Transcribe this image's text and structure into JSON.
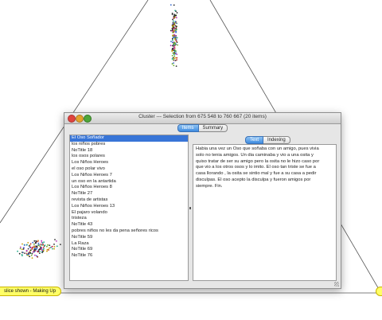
{
  "window": {
    "title": "Cluster --- Selection from 675 548 to 760 667 (20 items)",
    "tabs": [
      {
        "label": "Items",
        "active": true
      },
      {
        "label": "Summary",
        "active": false
      }
    ],
    "detail_tabs": [
      {
        "label": "Text",
        "active": true
      },
      {
        "label": "Indexing",
        "active": false
      }
    ]
  },
  "list": {
    "selected_index": 0,
    "items": [
      "El Oso Soñador",
      "los niños pobres",
      "NoTitle 18",
      "los osos polares",
      "Los Niños Heroes",
      "el oso polar vivo",
      "Los Niños Heroes 7",
      "un oso en la antartida",
      "Los Niños Heroes 8",
      "NoTitle 27",
      "revista de artistas",
      "Los Niños Heroes 13",
      "El pajaro volando",
      "tristeza",
      "NoTitle 43",
      "pobres niños no les da pena señores ricos",
      "NoTitle 59",
      "La Raza",
      "NoTitle 69",
      "NoTitle 76"
    ]
  },
  "detail": {
    "text": "Habia una vez un Oso que soñaba con un amigo, pues vivia\nsolo no tenia amigos. Un dia caminaba y vio a una osita y\nquiso tratar de ser su amigo pero la osita no le hizo caso por\nque vio a los otros osos y lo imito. El oso tan triste se fue a\ncasa llorando , la osita se sintio mal y fue a su casa a pedir\ndisculpas. El oso acepto la disculpa y fueron amigos por\nsiempre. Fin."
  },
  "status": {
    "label": "slice shown - Making Up"
  },
  "colors": {
    "selection": "#3875d7",
    "active_tab": "#3e8be0",
    "badge": "#ffff66"
  }
}
